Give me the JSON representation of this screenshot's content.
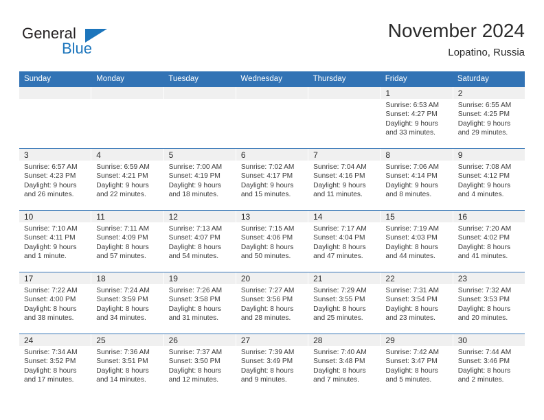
{
  "brand": {
    "name_part1": "General",
    "name_part2": "Blue"
  },
  "header": {
    "title": "November 2024",
    "subtitle": "Lopatino, Russia"
  },
  "colors": {
    "header_blue": "#3273b5",
    "brand_blue": "#1c75bc",
    "day_band": "#f0f0f0",
    "text": "#3a3a3a"
  },
  "weekdays": [
    "Sunday",
    "Monday",
    "Tuesday",
    "Wednesday",
    "Thursday",
    "Friday",
    "Saturday"
  ],
  "weeks": [
    [
      {
        "day": "",
        "sunrise": "",
        "sunset": "",
        "daylight": ""
      },
      {
        "day": "",
        "sunrise": "",
        "sunset": "",
        "daylight": ""
      },
      {
        "day": "",
        "sunrise": "",
        "sunset": "",
        "daylight": ""
      },
      {
        "day": "",
        "sunrise": "",
        "sunset": "",
        "daylight": ""
      },
      {
        "day": "",
        "sunrise": "",
        "sunset": "",
        "daylight": ""
      },
      {
        "day": "1",
        "sunrise": "Sunrise: 6:53 AM",
        "sunset": "Sunset: 4:27 PM",
        "daylight": "Daylight: 9 hours and 33 minutes."
      },
      {
        "day": "2",
        "sunrise": "Sunrise: 6:55 AM",
        "sunset": "Sunset: 4:25 PM",
        "daylight": "Daylight: 9 hours and 29 minutes."
      }
    ],
    [
      {
        "day": "3",
        "sunrise": "Sunrise: 6:57 AM",
        "sunset": "Sunset: 4:23 PM",
        "daylight": "Daylight: 9 hours and 26 minutes."
      },
      {
        "day": "4",
        "sunrise": "Sunrise: 6:59 AM",
        "sunset": "Sunset: 4:21 PM",
        "daylight": "Daylight: 9 hours and 22 minutes."
      },
      {
        "day": "5",
        "sunrise": "Sunrise: 7:00 AM",
        "sunset": "Sunset: 4:19 PM",
        "daylight": "Daylight: 9 hours and 18 minutes."
      },
      {
        "day": "6",
        "sunrise": "Sunrise: 7:02 AM",
        "sunset": "Sunset: 4:17 PM",
        "daylight": "Daylight: 9 hours and 15 minutes."
      },
      {
        "day": "7",
        "sunrise": "Sunrise: 7:04 AM",
        "sunset": "Sunset: 4:16 PM",
        "daylight": "Daylight: 9 hours and 11 minutes."
      },
      {
        "day": "8",
        "sunrise": "Sunrise: 7:06 AM",
        "sunset": "Sunset: 4:14 PM",
        "daylight": "Daylight: 9 hours and 8 minutes."
      },
      {
        "day": "9",
        "sunrise": "Sunrise: 7:08 AM",
        "sunset": "Sunset: 4:12 PM",
        "daylight": "Daylight: 9 hours and 4 minutes."
      }
    ],
    [
      {
        "day": "10",
        "sunrise": "Sunrise: 7:10 AM",
        "sunset": "Sunset: 4:11 PM",
        "daylight": "Daylight: 9 hours and 1 minute."
      },
      {
        "day": "11",
        "sunrise": "Sunrise: 7:11 AM",
        "sunset": "Sunset: 4:09 PM",
        "daylight": "Daylight: 8 hours and 57 minutes."
      },
      {
        "day": "12",
        "sunrise": "Sunrise: 7:13 AM",
        "sunset": "Sunset: 4:07 PM",
        "daylight": "Daylight: 8 hours and 54 minutes."
      },
      {
        "day": "13",
        "sunrise": "Sunrise: 7:15 AM",
        "sunset": "Sunset: 4:06 PM",
        "daylight": "Daylight: 8 hours and 50 minutes."
      },
      {
        "day": "14",
        "sunrise": "Sunrise: 7:17 AM",
        "sunset": "Sunset: 4:04 PM",
        "daylight": "Daylight: 8 hours and 47 minutes."
      },
      {
        "day": "15",
        "sunrise": "Sunrise: 7:19 AM",
        "sunset": "Sunset: 4:03 PM",
        "daylight": "Daylight: 8 hours and 44 minutes."
      },
      {
        "day": "16",
        "sunrise": "Sunrise: 7:20 AM",
        "sunset": "Sunset: 4:02 PM",
        "daylight": "Daylight: 8 hours and 41 minutes."
      }
    ],
    [
      {
        "day": "17",
        "sunrise": "Sunrise: 7:22 AM",
        "sunset": "Sunset: 4:00 PM",
        "daylight": "Daylight: 8 hours and 38 minutes."
      },
      {
        "day": "18",
        "sunrise": "Sunrise: 7:24 AM",
        "sunset": "Sunset: 3:59 PM",
        "daylight": "Daylight: 8 hours and 34 minutes."
      },
      {
        "day": "19",
        "sunrise": "Sunrise: 7:26 AM",
        "sunset": "Sunset: 3:58 PM",
        "daylight": "Daylight: 8 hours and 31 minutes."
      },
      {
        "day": "20",
        "sunrise": "Sunrise: 7:27 AM",
        "sunset": "Sunset: 3:56 PM",
        "daylight": "Daylight: 8 hours and 28 minutes."
      },
      {
        "day": "21",
        "sunrise": "Sunrise: 7:29 AM",
        "sunset": "Sunset: 3:55 PM",
        "daylight": "Daylight: 8 hours and 25 minutes."
      },
      {
        "day": "22",
        "sunrise": "Sunrise: 7:31 AM",
        "sunset": "Sunset: 3:54 PM",
        "daylight": "Daylight: 8 hours and 23 minutes."
      },
      {
        "day": "23",
        "sunrise": "Sunrise: 7:32 AM",
        "sunset": "Sunset: 3:53 PM",
        "daylight": "Daylight: 8 hours and 20 minutes."
      }
    ],
    [
      {
        "day": "24",
        "sunrise": "Sunrise: 7:34 AM",
        "sunset": "Sunset: 3:52 PM",
        "daylight": "Daylight: 8 hours and 17 minutes."
      },
      {
        "day": "25",
        "sunrise": "Sunrise: 7:36 AM",
        "sunset": "Sunset: 3:51 PM",
        "daylight": "Daylight: 8 hours and 14 minutes."
      },
      {
        "day": "26",
        "sunrise": "Sunrise: 7:37 AM",
        "sunset": "Sunset: 3:50 PM",
        "daylight": "Daylight: 8 hours and 12 minutes."
      },
      {
        "day": "27",
        "sunrise": "Sunrise: 7:39 AM",
        "sunset": "Sunset: 3:49 PM",
        "daylight": "Daylight: 8 hours and 9 minutes."
      },
      {
        "day": "28",
        "sunrise": "Sunrise: 7:40 AM",
        "sunset": "Sunset: 3:48 PM",
        "daylight": "Daylight: 8 hours and 7 minutes."
      },
      {
        "day": "29",
        "sunrise": "Sunrise: 7:42 AM",
        "sunset": "Sunset: 3:47 PM",
        "daylight": "Daylight: 8 hours and 5 minutes."
      },
      {
        "day": "30",
        "sunrise": "Sunrise: 7:44 AM",
        "sunset": "Sunset: 3:46 PM",
        "daylight": "Daylight: 8 hours and 2 minutes."
      }
    ]
  ]
}
